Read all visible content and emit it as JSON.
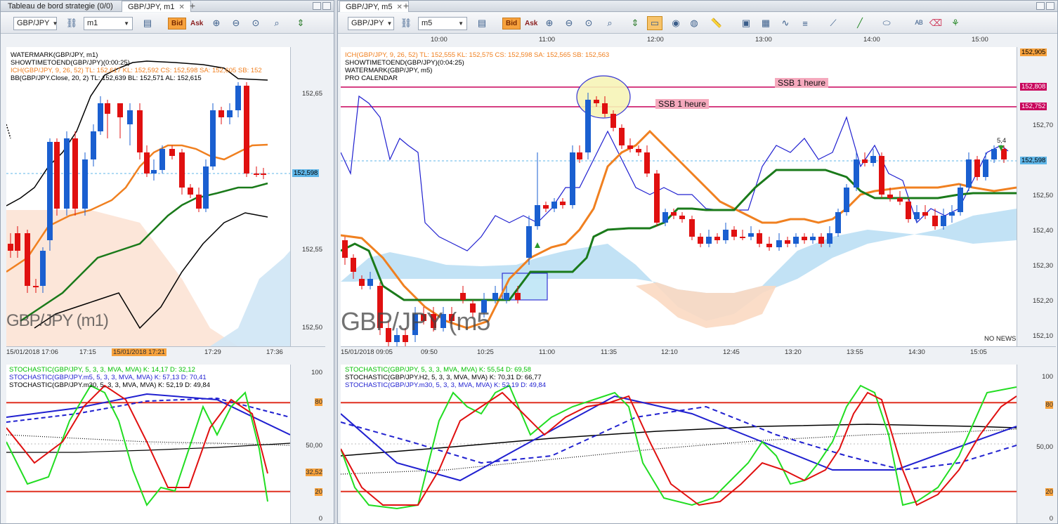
{
  "left": {
    "tabs": [
      {
        "label": "Tableau de bord strategie (0/0)"
      },
      {
        "label": "GBP/JPY, m1"
      }
    ],
    "toolbar": {
      "symbol": "GBP/JPY",
      "timeframe": "m1",
      "bid": "Bid",
      "ask": "Ask"
    },
    "chart": {
      "header": [
        {
          "text": "WATERMARK(GBP/JPY, m1)",
          "color": "#000000"
        },
        {
          "text": "SHOWTIMETOEND(GBP/JPY)(0:00:25)",
          "color": "#000000"
        },
        {
          "text": "ICH(GBP/JPY, 9, 26, 52)  TL: 152,617  KL: 152,592  CS: 152,598  SA: 152,605  SB: 152",
          "color": "#f08020"
        },
        {
          "text": "BB(GBP/JPY.Close, 20, 2)  TL: 152,639  BL: 152,571  AL: 152,615",
          "color": "#000000"
        }
      ],
      "watermark": "GBP/JPY (m1)",
      "price_labels": [
        "152,65",
        "152,55",
        "152,50"
      ],
      "current_price": "152,598",
      "time_labels": [
        "15/01/2018 17:06",
        "17:15",
        "15/01/2018 17:21",
        "17:29",
        "17:36"
      ]
    },
    "stoch": {
      "header": [
        {
          "text": "STOCHASTIC(GBP/JPY, 5, 3, 3, MVA, MVA)  K: 14,17  D: 32,12",
          "color": "#00c000"
        },
        {
          "text": "STOCHASTIC(GBP/JPY.m5, 5, 3, 3, MVA, MVA)  K: 57,13  D: 70,41",
          "color": "#2020d0"
        },
        {
          "text": "STOCHASTIC(GBP/JPY.m30, 5, 3, 3, MVA, MVA)  K: 52,19  D: 49,84",
          "color": "#000000"
        }
      ],
      "levels": [
        "100",
        "80",
        "50,00",
        "32,52",
        "20",
        "0"
      ]
    }
  },
  "right": {
    "tabs": [
      {
        "label": "GBP/JPY, m5"
      }
    ],
    "toolbar": {
      "symbol": "GBP/JPY",
      "timeframe": "m5",
      "bid": "Bid",
      "ask": "Ask"
    },
    "top_times": [
      "10:00",
      "11:00",
      "12:00",
      "13:00",
      "14:00",
      "15:00"
    ],
    "chart": {
      "header": [
        {
          "text": "ICH(GBP/JPY, 9, 26, 52)  TL: 152,555  KL: 152,575  CS: 152,598  SA: 152,565  SB: 152,563",
          "color": "#f08020"
        },
        {
          "text": "SHOWTIMETOEND(GBP/JPY)(0:04:25)",
          "color": "#000000"
        },
        {
          "text": "WATERMARK(GBP/JPY, m5)",
          "color": "#000000"
        },
        {
          "text": "PRO CALENDAR",
          "color": "#000000"
        }
      ],
      "watermark": "GBP/JPY (m5",
      "ssb_label": "SSB 1 heure",
      "no_news": "NO NEWS",
      "marker": "5,4",
      "price_labels": [
        "152,905",
        "152,808",
        "152,752",
        "152,70",
        "152,598",
        "152,50",
        "152,40",
        "152,30",
        "152,20",
        "152,10"
      ],
      "time_labels": [
        "15/01/2018 09:05",
        "09:50",
        "10:25",
        "11:00",
        "11:35",
        "12:10",
        "12:45",
        "13:20",
        "13:55",
        "14:30",
        "15:05"
      ]
    },
    "stoch": {
      "header": [
        {
          "text": "STOCHASTIC(GBP/JPY, 5, 3, 3, MVA, MVA)  K: 55,54  D: 69,58",
          "color": "#00c000"
        },
        {
          "text": "STOCHASTIC(GBP/JPY.H2, 5, 3, 3, MVA, MVA)  K: 70,31  D: 66,77",
          "color": "#000000"
        },
        {
          "text": "STOCHASTIC(GBP/JPY.m30, 5, 3, 3, MVA, MVA)  K: 52,19  D: 49,84",
          "color": "#2020d0"
        }
      ],
      "levels": [
        "100",
        "80",
        "50,00",
        "20",
        "0"
      ]
    }
  },
  "colors": {
    "up": "#1a5fd0",
    "down": "#e01010",
    "ichimoku_tl": "#f08020",
    "ichimoku_kl": "#1a7a1a",
    "ssb_line": "#c8005a",
    "accent": "#f7a23d"
  }
}
